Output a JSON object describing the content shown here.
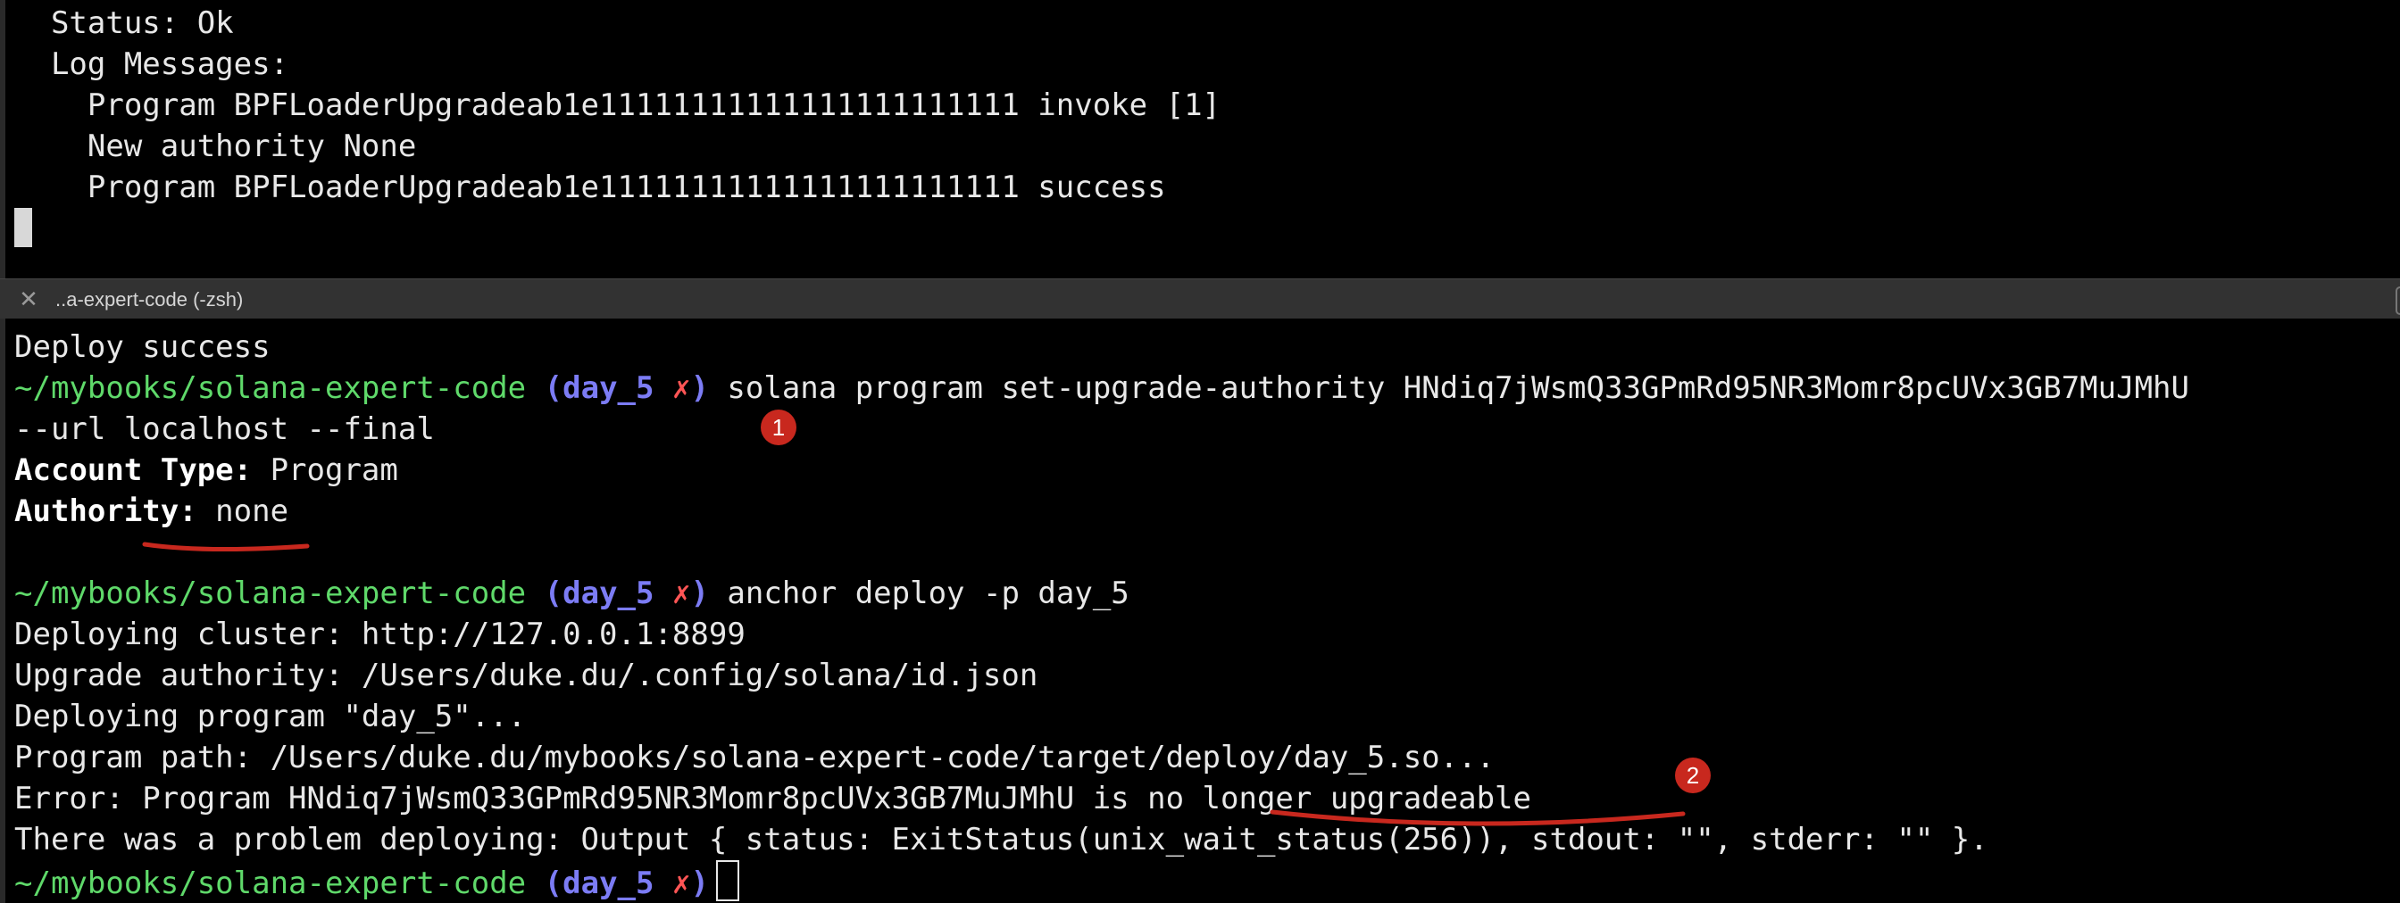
{
  "top_pane": {
    "status": "  Status: Ok",
    "log_header": "  Log Messages:",
    "log_lines": [
      "    Program BPFLoaderUpgradeab1e11111111111111111111111 invoke [1]",
      "    New authority None",
      "    Program BPFLoaderUpgradeab1e11111111111111111111111 success"
    ]
  },
  "tab": {
    "close_glyph": "✕",
    "title": "..a-expert-code (-zsh)"
  },
  "prompt": {
    "path": "~/mybooks/solana-expert-code",
    "branch_open": "(",
    "branch": "day_5",
    "dirty_mark": "✗",
    "branch_close": ")"
  },
  "bottom_pane": {
    "deploy_success": "Deploy success",
    "cmd1": "solana program set-upgrade-authority HNdiq7jWsmQ33GPmRd95NR3Momr8pcUVx3GB7MuJMhU",
    "cmd1_cont": "--url localhost --final",
    "account_type_label": "Account Type:",
    "account_type_value": " Program",
    "authority_label": "Authority:",
    "authority_value": " none",
    "cmd2": "anchor deploy -p day_5",
    "out_lines": [
      "Deploying cluster: http://127.0.0.1:8899",
      "Upgrade authority: /Users/duke.du/.config/solana/id.json",
      "Deploying program \"day_5\"...",
      "Program path: /Users/duke.du/mybooks/solana-expert-code/target/deploy/day_5.so...",
      "Error: Program HNdiq7jWsmQ33GPmRd95NR3Momr8pcUVx3GB7MuJMhU is no longer upgradeable",
      "There was a problem deploying: Output { status: ExitStatus(unix_wait_status(256)), stdout: \"\", stderr: \"\" }."
    ]
  },
  "annotations": {
    "marker_1": "1",
    "marker_2": "2",
    "color": "#c8281e"
  }
}
